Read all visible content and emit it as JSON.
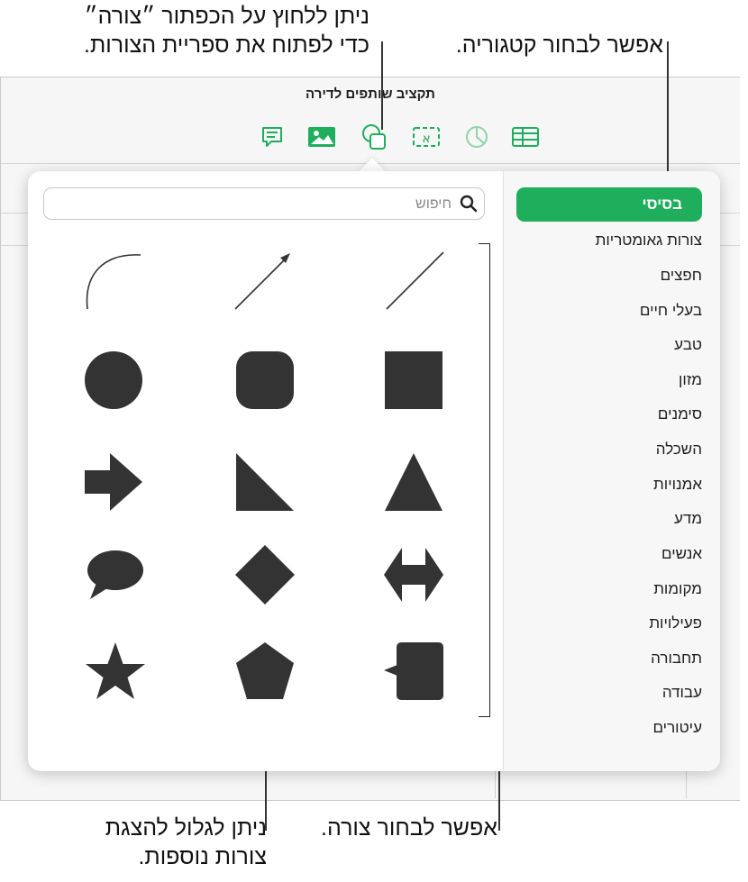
{
  "callouts": {
    "tap_shape_line1": "ניתן ללחוץ על הכפתור ״צורה״",
    "tap_shape_line2": "כדי לפתוח את ספריית הצורות.",
    "choose_category": "אפשר לבחור קטגוריה.",
    "scroll_line1": "ניתן לגלול להצגת",
    "scroll_line2": "צורות נוספות.",
    "choose_shape": "אפשר לבחור צורה."
  },
  "document": {
    "title": "תקציב שותפים לדירה"
  },
  "toolbar": {
    "buttons": [
      "table-icon",
      "chart-icon",
      "text-icon",
      "shape-icon",
      "media-icon",
      "comment-icon"
    ],
    "text_button_glyph": "א"
  },
  "search": {
    "placeholder": "חיפוש",
    "value": ""
  },
  "categories": {
    "selected": "בסיסי",
    "items": [
      "צורות גאומטריות",
      "חפצים",
      "בעלי חיים",
      "טבע",
      "מזון",
      "סימנים",
      "השכלה",
      "אמנויות",
      "מדע",
      "אנשים",
      "מקומות",
      "פעילויות",
      "תחבורה",
      "עבודה",
      "עיטורים"
    ]
  },
  "shapes": {
    "rows": [
      [
        "curve",
        "arrow-line",
        "line"
      ],
      [
        "circle",
        "rounded-square",
        "square"
      ],
      [
        "right-arrow",
        "right-triangle",
        "triangle"
      ],
      [
        "speech-bubble",
        "diamond",
        "double-arrow"
      ],
      [
        "star",
        "pentagon",
        "callout-square"
      ]
    ]
  },
  "colors": {
    "accent": "#1faf5c",
    "shape_fill": "#333333",
    "toolbar_icon": "#1faf5c"
  }
}
